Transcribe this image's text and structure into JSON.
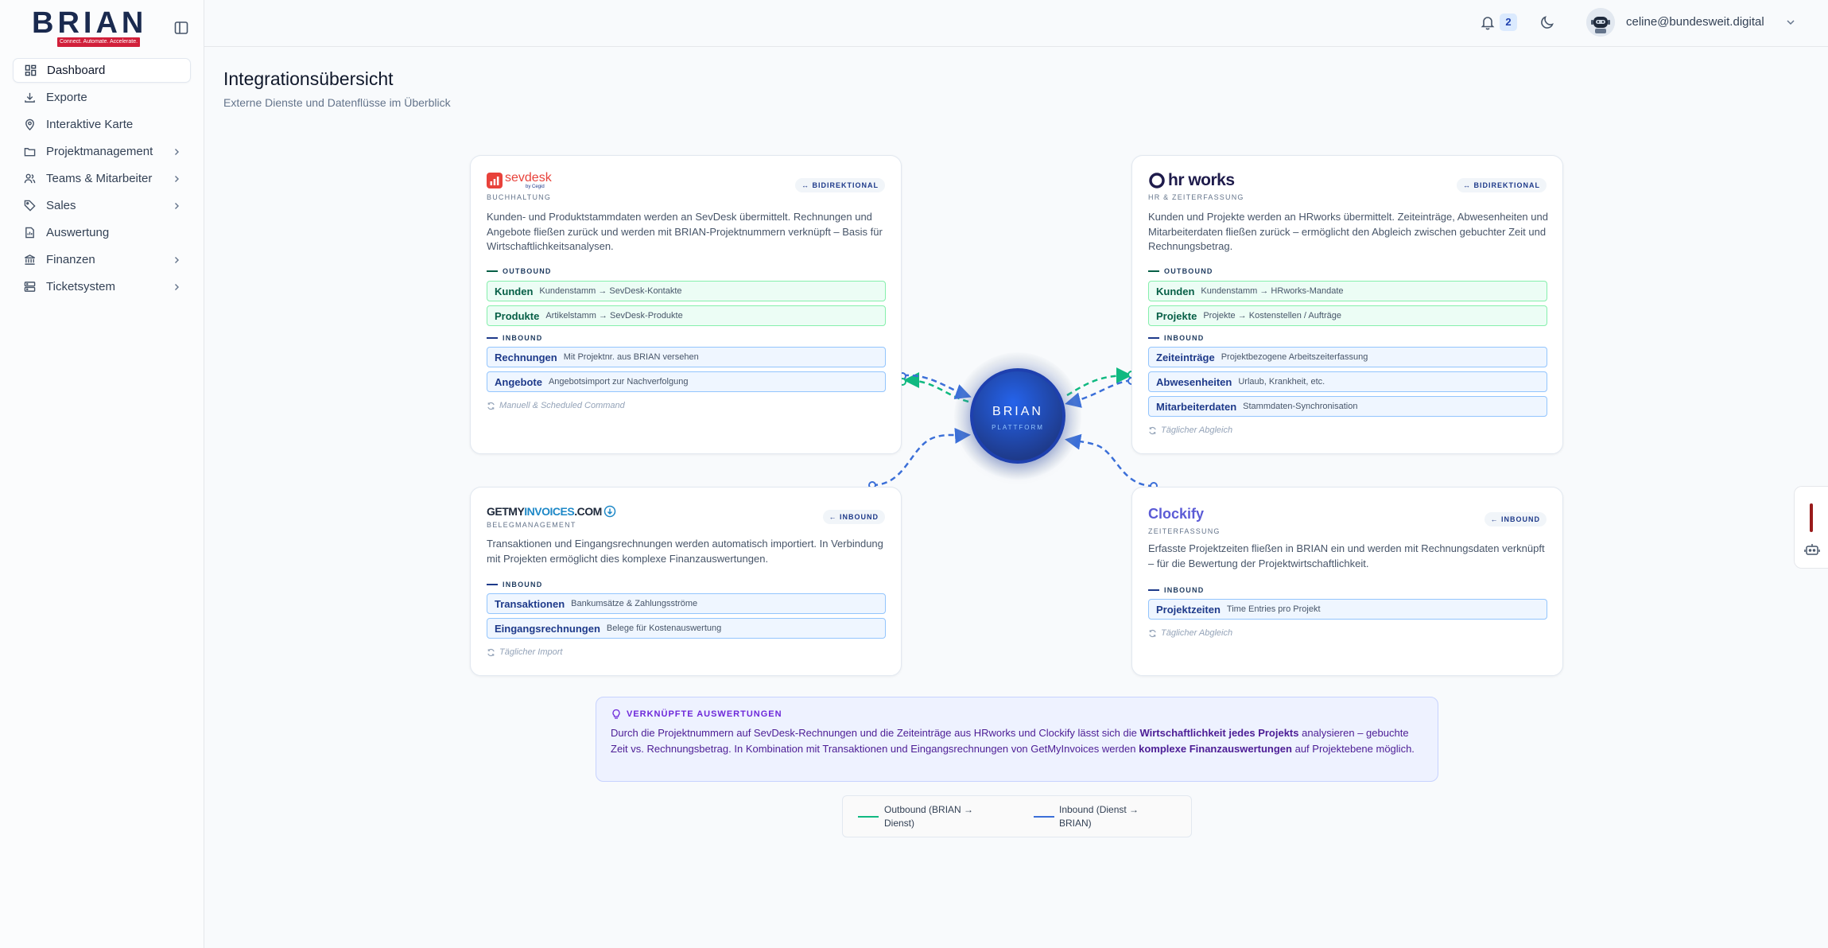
{
  "app": {
    "logo_text": "BRIAN",
    "logo_tagline": "Connect. Automate. Accelerate."
  },
  "sidebar": {
    "items": [
      {
        "label": "Dashboard",
        "icon": "grid-icon",
        "active": true,
        "expandable": false
      },
      {
        "label": "Exporte",
        "icon": "download-icon",
        "active": false,
        "expandable": false
      },
      {
        "label": "Interaktive Karte",
        "icon": "map-pin-icon",
        "active": false,
        "expandable": false
      },
      {
        "label": "Projektmanagement",
        "icon": "folder-icon",
        "active": false,
        "expandable": true
      },
      {
        "label": "Teams & Mitarbeiter",
        "icon": "users-icon",
        "active": false,
        "expandable": true
      },
      {
        "label": "Sales",
        "icon": "tag-icon",
        "active": false,
        "expandable": true
      },
      {
        "label": "Auswertung",
        "icon": "report-icon",
        "active": false,
        "expandable": false
      },
      {
        "label": "Finanzen",
        "icon": "bank-icon",
        "active": false,
        "expandable": true
      },
      {
        "label": "Ticketsystem",
        "icon": "server-icon",
        "active": false,
        "expandable": true
      }
    ]
  },
  "topbar": {
    "notification_count": "2",
    "user_email": "celine@bundesweit.digital"
  },
  "page": {
    "title": "Integrationsübersicht",
    "subtitle": "Externe Dienste und Datenflüsse im Überblick"
  },
  "hub": {
    "title": "BRIAN",
    "subtitle": "PLATTFORM"
  },
  "cards": {
    "sevdesk": {
      "brand": "sevdesk",
      "brand_sub": "by Cegid",
      "category": "BUCHHALTUNG",
      "direction": "↔ BIDIREKTIONAL",
      "description": "Kunden- und Produktstammdaten werden an SevDesk übermittelt. Rechnungen und Angebote fließen zurück und werden mit BRIAN-Projektnummern verknüpft – Basis für Wirtschaftlichkeitsanalysen.",
      "outbound_label": "OUTBOUND",
      "outbound": [
        {
          "name": "Kunden",
          "detail": "Kundenstamm → SevDesk-Kontakte"
        },
        {
          "name": "Produkte",
          "detail": "Artikelstamm → SevDesk-Produkte"
        }
      ],
      "inbound_label": "INBOUND",
      "inbound": [
        {
          "name": "Rechnungen",
          "detail": "Mit Projektnr. aus BRIAN versehen"
        },
        {
          "name": "Angebote",
          "detail": "Angebotsimport zur Nachverfolgung"
        }
      ],
      "footer": "Manuell & Scheduled Command"
    },
    "hrworks": {
      "brand": "hr works",
      "category": "HR & ZEITERFASSUNG",
      "direction": "↔ BIDIREKTIONAL",
      "description": "Kunden und Projekte werden an HRworks übermittelt. Zeiteinträge, Abwesenheiten und Mitarbeiterdaten fließen zurück – ermöglicht den Abgleich zwischen gebuchter Zeit und Rechnungsbetrag.",
      "outbound_label": "OUTBOUND",
      "outbound": [
        {
          "name": "Kunden",
          "detail": "Kundenstamm → HRworks-Mandate"
        },
        {
          "name": "Projekte",
          "detail": "Projekte → Kostenstellen / Aufträge"
        }
      ],
      "inbound_label": "INBOUND",
      "inbound": [
        {
          "name": "Zeiteinträge",
          "detail": "Projektbezogene Arbeitszeiterfassung"
        },
        {
          "name": "Abwesenheiten",
          "detail": "Urlaub, Krankheit, etc."
        },
        {
          "name": "Mitarbeiterdaten",
          "detail": "Stammdaten-Synchronisation"
        }
      ],
      "footer": "Täglicher Abgleich"
    },
    "getmyinvoices": {
      "brand_a": "GETMY",
      "brand_b": "INVOICES",
      "brand_c": ".COM",
      "category": "BELEGMANAGEMENT",
      "direction": "← INBOUND",
      "description": "Transaktionen und Eingangsrechnungen werden automatisch importiert. In Verbindung mit Projekten ermöglicht dies komplexe Finanzauswertungen.",
      "inbound_label": "INBOUND",
      "inbound": [
        {
          "name": "Transaktionen",
          "detail": "Bankumsätze & Zahlungsströme"
        },
        {
          "name": "Eingangsrechnungen",
          "detail": "Belege für Kostenauswertung"
        }
      ],
      "footer": "Täglicher Import"
    },
    "clockify": {
      "brand": "Clockify",
      "category": "ZEITERFASSUNG",
      "direction": "← INBOUND",
      "description": "Erfasste Projektzeiten fließen in BRIAN ein und werden mit Rechnungsdaten verknüpft – für die Bewertung der Projektwirtschaftlichkeit.",
      "inbound_label": "INBOUND",
      "inbound": [
        {
          "name": "Projektzeiten",
          "detail": "Time Entries pro Projekt"
        }
      ],
      "footer": "Täglicher Abgleich"
    }
  },
  "insight": {
    "title": "VERKNÜPFTE AUSWERTUNGEN",
    "text_1": "Durch die Projektnummern auf SevDesk-Rechnungen und die Zeiteinträge aus HRworks und Clockify lässt sich die ",
    "bold_1": "Wirtschaftlichkeit jedes Projekts",
    "text_2": " analysieren – gebuchte Zeit vs. Rechnungsbetrag. In Kombination mit Transaktionen und Eingangsrechnungen von GetMyInvoices werden ",
    "bold_2": "komplexe Finanzauswertungen",
    "text_3": " auf Projektebene möglich."
  },
  "legend": {
    "outbound": "Outbound (BRIAN → Dienst)",
    "inbound": "Inbound (Dienst → BRIAN)"
  },
  "colors": {
    "outbound": "#10b981",
    "inbound": "#3b6fd8",
    "hub": "#1e40af",
    "accent_insight": "#6d28d9",
    "sevdesk_red": "#e8423b",
    "hrworks_navy": "#1e1b4b",
    "clockify_blue": "#5b5bd6",
    "getmyinvoices_blue": "#1e88c7"
  }
}
